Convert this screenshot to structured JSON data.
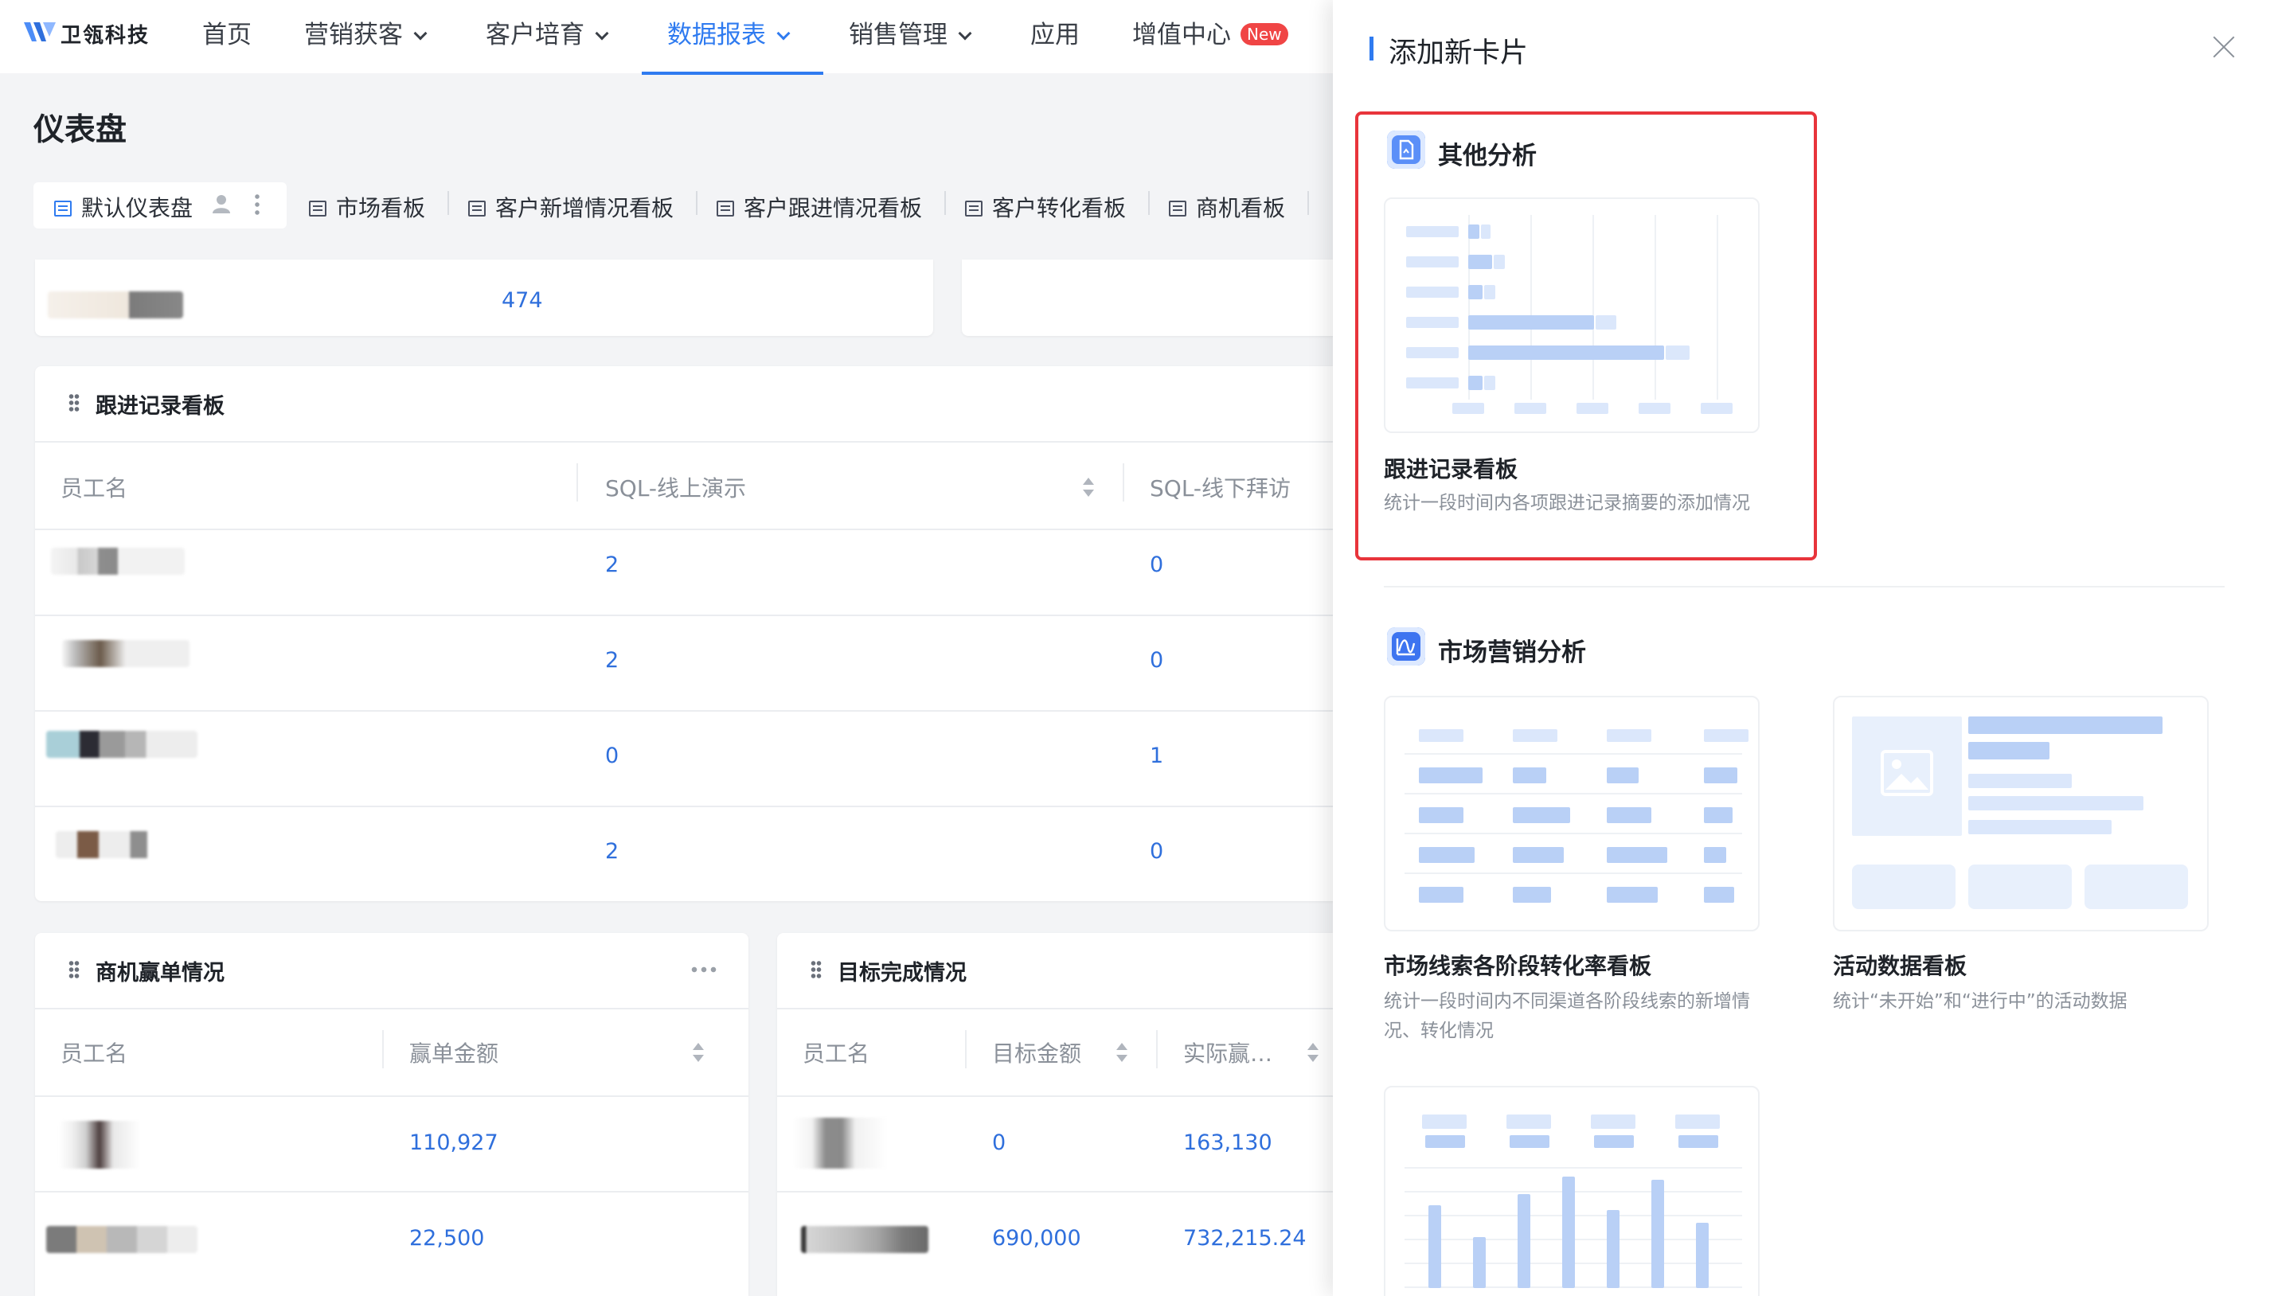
{
  "nav": {
    "logo_text": "卫瓴科技",
    "items": [
      "首页",
      "营销获客",
      "客户培育",
      "数据报表",
      "销售管理",
      "应用",
      "增值中心"
    ],
    "new_badge": "New"
  },
  "page": {
    "title": "仪表盘",
    "tabs": [
      "默认仪表盘",
      "市场看板",
      "客户新增情况看板",
      "客户跟进情况看板",
      "客户转化看板",
      "商机看板"
    ]
  },
  "top_card": {
    "value": "474"
  },
  "followup_card": {
    "title": "跟进记录看板",
    "headers": [
      "员工名",
      "SQL-线上演示",
      "SQL-线下拜访"
    ],
    "rows": [
      [
        "2",
        "0"
      ],
      [
        "2",
        "0"
      ],
      [
        "0",
        "1"
      ],
      [
        "2",
        "0"
      ]
    ]
  },
  "deal_card": {
    "title": "商机赢单情况",
    "headers": [
      "员工名",
      "赢单金额"
    ],
    "rows": [
      "110,927",
      "22,500"
    ]
  },
  "target_card": {
    "title": "目标完成情况",
    "headers": [
      "员工名",
      "目标金额",
      "实际赢…"
    ],
    "rows": [
      [
        "0",
        "163,130"
      ],
      [
        "690,000",
        "732,215.24"
      ]
    ]
  },
  "drawer": {
    "title": "添加新卡片",
    "sections": [
      {
        "title": "其他分析",
        "cards": [
          {
            "name": "跟进记录看板",
            "desc": "统计一段时间内各项跟进记录摘要的添加情况"
          }
        ]
      },
      {
        "title": "市场营销分析",
        "cards": [
          {
            "name": "市场线索各阶段转化率看板",
            "desc": "统计一段时间内不同渠道各阶段线索的新增情况、转化情况"
          },
          {
            "name": "活动数据看板",
            "desc": "统计“未开始”和“进行中”的活动数据"
          }
        ]
      }
    ]
  },
  "colors": {
    "accent": "#2f7bf0",
    "link": "#2f6fdc",
    "highlight": "#e8343b",
    "badge": "#f04545"
  }
}
